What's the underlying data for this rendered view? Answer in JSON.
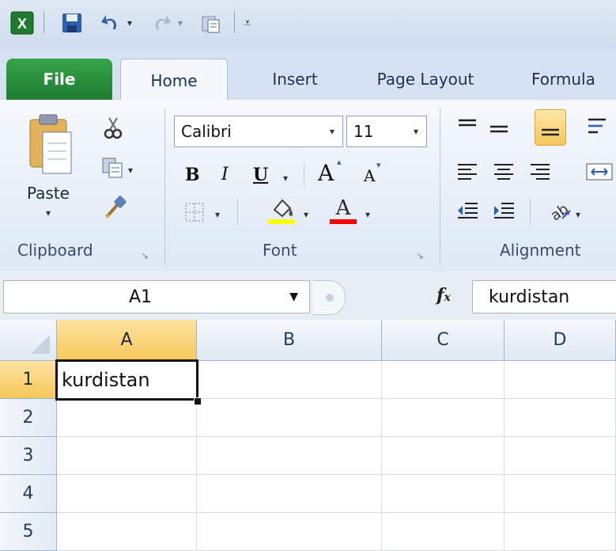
{
  "ribbon_tabs": {
    "file": "File",
    "home": "Home",
    "insert": "Insert",
    "page_layout": "Page Layout",
    "formulas": "Formula"
  },
  "clipboard": {
    "paste_label": "Paste",
    "group_label": "Clipboard"
  },
  "font": {
    "name": "Calibri",
    "size": "11",
    "bold": "B",
    "italic": "I",
    "underline": "U",
    "grow": "A",
    "shrink": "A",
    "color_letter": "A",
    "group_label": "Font"
  },
  "alignment": {
    "group_label": "Alignment"
  },
  "formula_bar": {
    "name_box": "A1",
    "fx": "fx",
    "content": "kurdistan"
  },
  "grid": {
    "columns": [
      "A",
      "B",
      "C",
      "D"
    ],
    "rows": [
      "1",
      "2",
      "3",
      "4",
      "5"
    ],
    "cells": {
      "A1": "kurdistan"
    }
  },
  "colors": {
    "file_tab": "#2a8f3e",
    "selection_header": "#f7c75b",
    "highlight_yellow": "#ffff00",
    "font_red": "#ff0000"
  }
}
